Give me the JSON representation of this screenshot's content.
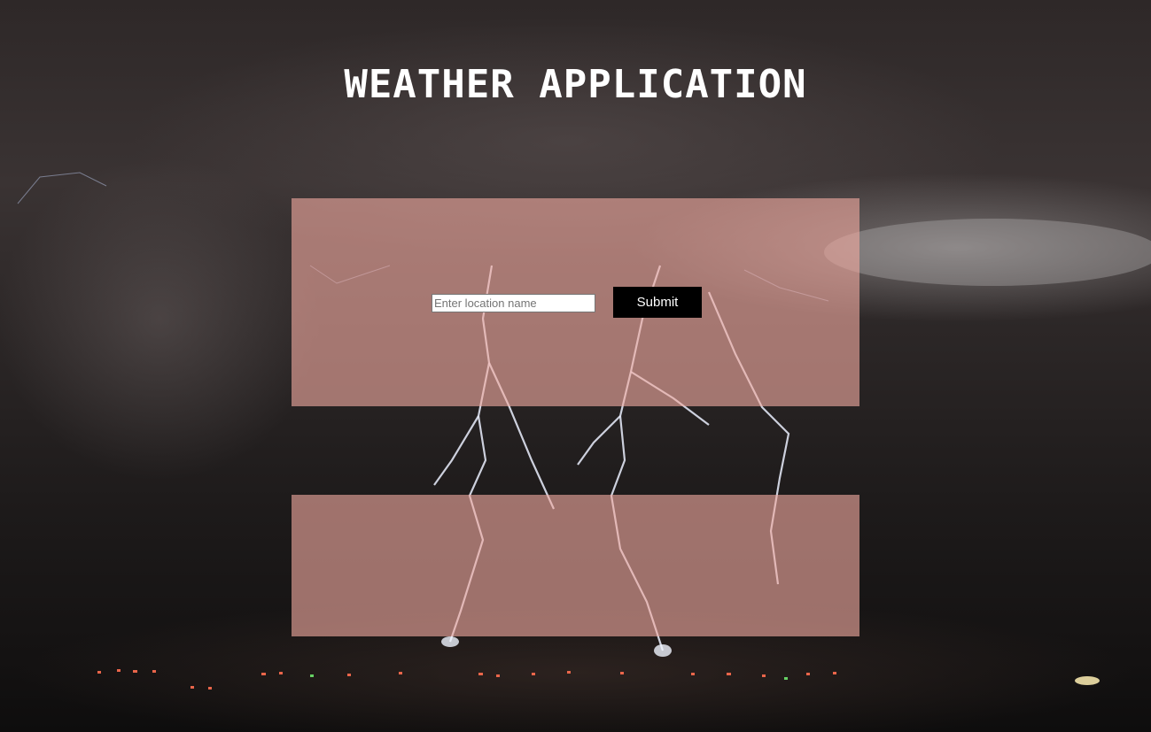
{
  "header": {
    "title": "WEATHER APPLICATION"
  },
  "search": {
    "placeholder": "Enter location name",
    "value": "",
    "submit_label": "Submit"
  },
  "results": {
    "content": ""
  },
  "colors": {
    "panel": "#f0aaa0",
    "button": "#000000",
    "title": "#ffffff"
  }
}
